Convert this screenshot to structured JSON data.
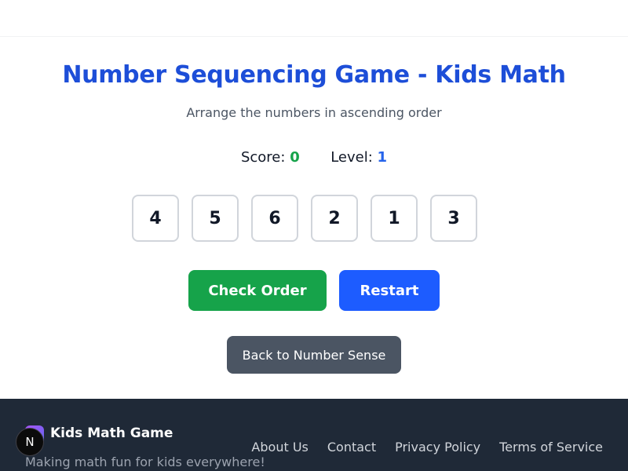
{
  "header": {
    "title": "Number Sequencing Game - Kids Math",
    "subtitle": "Arrange the numbers in ascending order"
  },
  "stats": {
    "score_label": "Score:",
    "score_value": "0",
    "level_label": "Level:",
    "level_value": "1"
  },
  "tiles": [
    "4",
    "5",
    "6",
    "2",
    "1",
    "3"
  ],
  "buttons": {
    "check": "Check Order",
    "restart": "Restart",
    "back": "Back to Number Sense"
  },
  "footer": {
    "brand": "Kids Math Game",
    "tagline": "Making math fun for kids everywhere!",
    "links": [
      "About Us",
      "Contact",
      "Privacy Policy",
      "Terms of Service"
    ]
  },
  "dev_badge": "N",
  "colors": {
    "title": "#1d4ed8",
    "score": "#16a34a",
    "level": "#2563eb",
    "check_button": "#16a34a",
    "restart_button": "#1d5cff",
    "back_button": "#4b5563",
    "footer_bg": "#1f2937"
  }
}
